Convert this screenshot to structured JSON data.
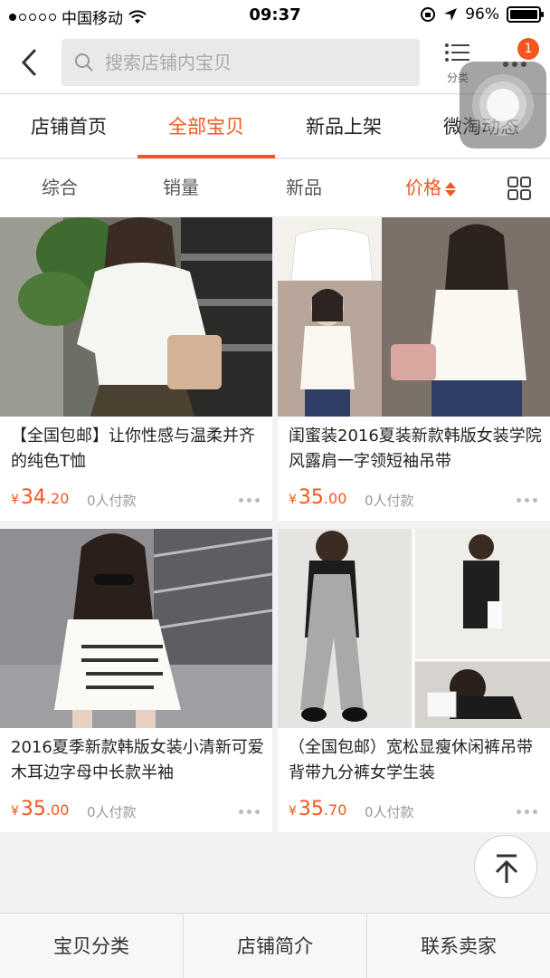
{
  "status_bar": {
    "carrier": "中国移动",
    "time": "09:37",
    "battery": "96%"
  },
  "search": {
    "placeholder": "搜索店铺内宝贝",
    "category_label": "分类",
    "badge_count": "1"
  },
  "tabs": [
    {
      "label": "店铺首页"
    },
    {
      "label": "全部宝贝"
    },
    {
      "label": "新品上架"
    },
    {
      "label": "微淘动态"
    }
  ],
  "sort": [
    {
      "label": "综合"
    },
    {
      "label": "销量"
    },
    {
      "label": "新品"
    },
    {
      "label": "价格"
    }
  ],
  "products": [
    {
      "title": "【全国包邮】让你性感与温柔并齐的纯色T恤",
      "price_int": "34",
      "price_dec": ".20",
      "currency": "¥",
      "sales": "0人付款"
    },
    {
      "title": "闺蜜装2016夏装新款韩版女装学院风露肩一字领短袖吊带",
      "price_int": "35",
      "price_dec": ".00",
      "currency": "¥",
      "sales": "0人付款"
    },
    {
      "title": "2016夏季新款韩版女装小清新可爱木耳边字母中长款半袖",
      "price_int": "35",
      "price_dec": ".00",
      "currency": "¥",
      "sales": "0人付款"
    },
    {
      "title": "（全国包邮）宽松显瘦休闲裤吊带背带九分裤女学生装",
      "price_int": "35",
      "price_dec": ".70",
      "currency": "¥",
      "sales": "0人付款"
    }
  ],
  "bottom_bar": [
    {
      "label": "宝贝分类"
    },
    {
      "label": "店铺简介"
    },
    {
      "label": "联系卖家"
    }
  ],
  "colors": {
    "accent": "#f5561e",
    "text": "#222222",
    "muted": "#999999"
  }
}
